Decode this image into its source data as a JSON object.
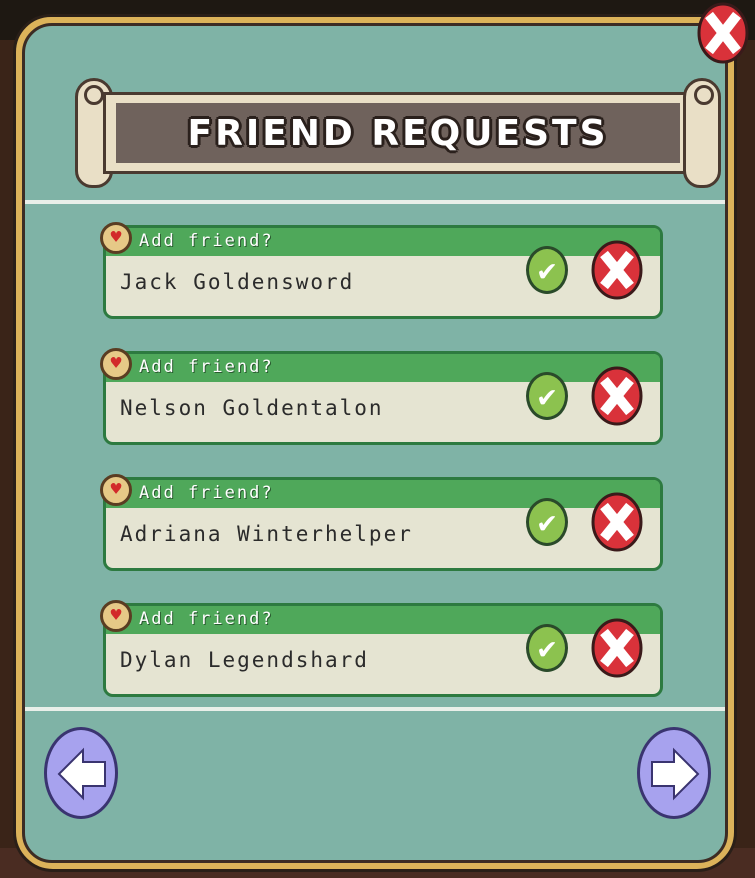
{
  "dialog": {
    "title": "FRIEND REQUESTS"
  },
  "requests": [
    {
      "prompt": "Add friend?",
      "name": "Jack Goldensword"
    },
    {
      "prompt": "Add friend?",
      "name": "Nelson Goldentalon"
    },
    {
      "prompt": "Add friend?",
      "name": "Adriana Winterhelper"
    },
    {
      "prompt": "Add friend?",
      "name": "Dylan Legendshard"
    }
  ],
  "icons": {
    "close": "close-icon",
    "accept": "check-icon",
    "decline": "x-icon",
    "heart": "heart-icon",
    "prev": "arrow-left-icon",
    "next": "arrow-right-icon"
  },
  "colors": {
    "panel_bg": "#7fb3a6",
    "panel_border": "#dcb35a",
    "card_header": "#4fa85a",
    "accept": "#8cc24f",
    "decline": "#d9323a",
    "nav": "#a7a2ee"
  }
}
